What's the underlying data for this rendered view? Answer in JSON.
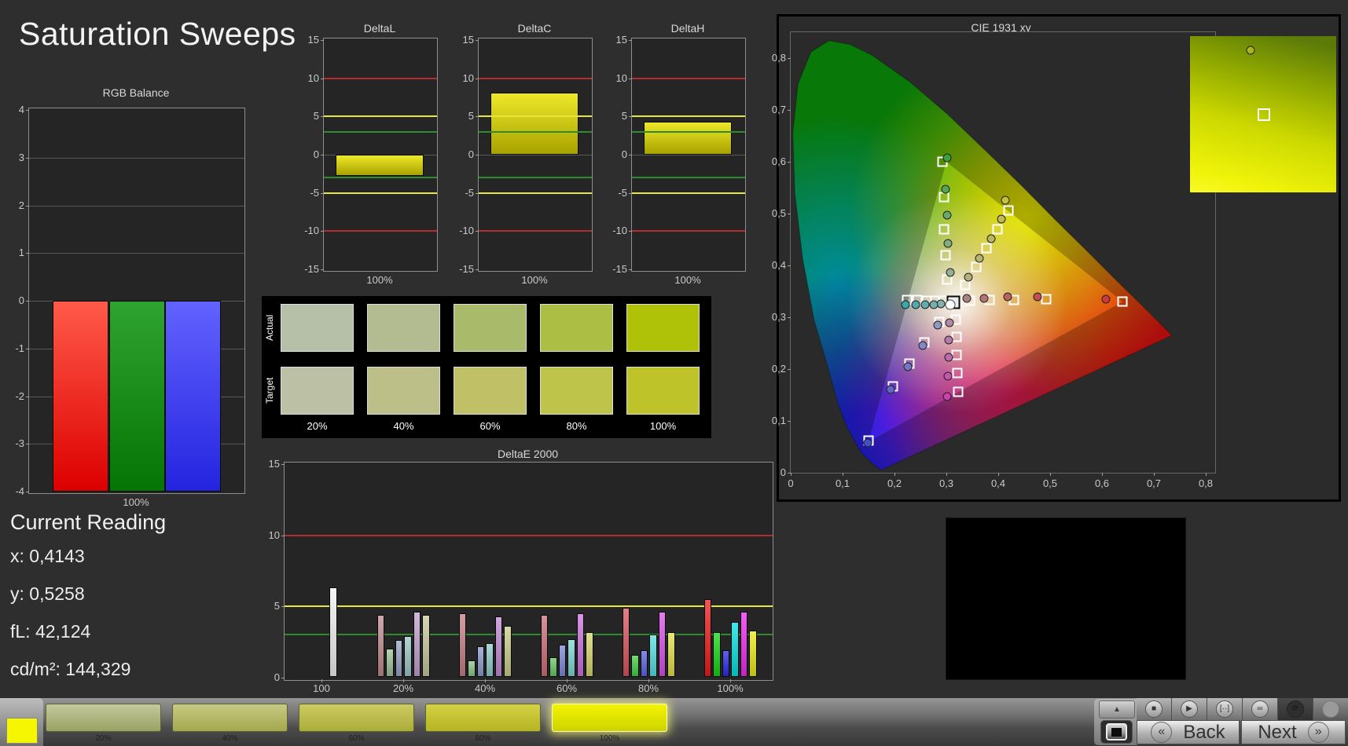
{
  "page": {
    "title": "Saturation Sweeps"
  },
  "reading": {
    "heading": "Current Reading",
    "items": [
      {
        "label": "x",
        "value": "0,4143"
      },
      {
        "label": "y",
        "value": "0,5258"
      },
      {
        "label": "fL",
        "value": "42,124"
      },
      {
        "label": "cd/m²",
        "value": "144,329"
      }
    ]
  },
  "rgb_balance": {
    "title": "RGB Balance",
    "x_label": "100%",
    "y_ticks": [
      4,
      3,
      2,
      1,
      0,
      -1,
      -2,
      -3,
      -4
    ],
    "bars": [
      {
        "name": "red",
        "value": -4,
        "c1": "#ff5a4a",
        "c2": "#dc0000"
      },
      {
        "name": "green",
        "value": -4,
        "c1": "#2fa32f",
        "c2": "#057505"
      },
      {
        "name": "blue",
        "value": -4,
        "c1": "#6262ff",
        "c2": "#2424e0"
      }
    ]
  },
  "delta_charts": {
    "y_ticks": [
      15,
      10,
      5,
      0,
      -5,
      -10,
      -15
    ],
    "x_label": "100%",
    "limit_lines": [
      {
        "value": 10,
        "color": "#b62b2b"
      },
      {
        "value": -10,
        "color": "#b62b2b"
      },
      {
        "value": 5,
        "color": "#e6e63e"
      },
      {
        "value": -5,
        "color": "#e6e63e"
      },
      {
        "value": 3,
        "color": "#2e8b2e"
      },
      {
        "value": -3,
        "color": "#2e8b2e"
      }
    ],
    "bar_c1": "#eee82a",
    "bar_c2": "#a8a200",
    "charts": [
      {
        "title": "DeltaL",
        "value": -2.8
      },
      {
        "title": "DeltaC",
        "value": 8.1
      },
      {
        "title": "DeltaH",
        "value": 4.3
      }
    ]
  },
  "swatch_panel": {
    "row_labels": [
      "Actual",
      "Target"
    ],
    "col_labels": [
      "20%",
      "40%",
      "60%",
      "80%",
      "100%"
    ],
    "actual": [
      "#b6bfa8",
      "#b2bc90",
      "#a9bb6b",
      "#adbe45",
      "#b0c207"
    ],
    "target": [
      "#bcc0a5",
      "#bdbf88",
      "#c0c166",
      "#bec34a",
      "#bdc329"
    ]
  },
  "deltae": {
    "title": "DeltaE 2000",
    "y_ticks": [
      15,
      10,
      5,
      0
    ],
    "limit_lines": [
      {
        "value": 10,
        "color": "#b62b2b"
      },
      {
        "value": 5,
        "color": "#e6e63e"
      },
      {
        "value": 3,
        "color": "#2e8b2e"
      }
    ],
    "groups": [
      {
        "label": "100",
        "bars": [
          {
            "value": 6.3,
            "color": "#f2f2f2"
          }
        ]
      },
      {
        "label": "20%",
        "bars": [
          {
            "value": 4.4,
            "color": "#c08a90"
          },
          {
            "value": 2.0,
            "color": "#9fc19a"
          },
          {
            "value": 2.6,
            "color": "#9aa3c6"
          },
          {
            "value": 2.9,
            "color": "#9cc6c6"
          },
          {
            "value": 4.6,
            "color": "#c2a0ce"
          },
          {
            "value": 4.4,
            "color": "#c6c79e"
          }
        ]
      },
      {
        "label": "40%",
        "bars": [
          {
            "value": 4.5,
            "color": "#c47e86"
          },
          {
            "value": 1.2,
            "color": "#8cc487"
          },
          {
            "value": 2.2,
            "color": "#8d99cc"
          },
          {
            "value": 2.4,
            "color": "#8ecccc"
          },
          {
            "value": 4.3,
            "color": "#c28ad4"
          },
          {
            "value": 3.6,
            "color": "#cccc8c"
          }
        ]
      },
      {
        "label": "60%",
        "bars": [
          {
            "value": 4.4,
            "color": "#cc6e78"
          },
          {
            "value": 1.4,
            "color": "#66c666"
          },
          {
            "value": 2.3,
            "color": "#7c87d8"
          },
          {
            "value": 2.7,
            "color": "#7ed6d6"
          },
          {
            "value": 4.5,
            "color": "#cc70de"
          },
          {
            "value": 3.2,
            "color": "#d6d66e"
          }
        ]
      },
      {
        "label": "80%",
        "bars": [
          {
            "value": 4.9,
            "color": "#d8545f"
          },
          {
            "value": 1.6,
            "color": "#44d044"
          },
          {
            "value": 1.9,
            "color": "#5a64e2"
          },
          {
            "value": 3.0,
            "color": "#50e0e0"
          },
          {
            "value": 4.6,
            "color": "#da50ea"
          },
          {
            "value": 3.2,
            "color": "#e0e04a"
          }
        ]
      },
      {
        "label": "100%",
        "bars": [
          {
            "value": 5.5,
            "color": "#ee1c1c"
          },
          {
            "value": 3.2,
            "color": "#16d416"
          },
          {
            "value": 1.9,
            "color": "#2a2ae8"
          },
          {
            "value": 3.9,
            "color": "#00e2e2"
          },
          {
            "value": 4.6,
            "color": "#ee2aee"
          },
          {
            "value": 3.3,
            "color": "#e8e818"
          }
        ]
      }
    ]
  },
  "cie": {
    "title": "CIE 1931 xy",
    "x_ticks": [
      "0",
      "0,1",
      "0,2",
      "0,3",
      "0,4",
      "0,5",
      "0,6",
      "0,7",
      "0,8"
    ],
    "y_ticks": [
      "0,8",
      "0,7",
      "0,6",
      "0,5",
      "0,4",
      "0,3",
      "0,2",
      "0,1",
      "0"
    ],
    "triangle": {
      "red": [
        0.64,
        0.33
      ],
      "green": [
        0.3,
        0.6
      ],
      "blue": [
        0.15,
        0.06
      ]
    },
    "white_point": {
      "target": [
        0.313,
        0.329
      ],
      "measured": [
        0.307,
        0.325
      ]
    },
    "sweeps": [
      {
        "name": "red",
        "targets": [
          [
            0.345,
            0.332
          ],
          [
            0.383,
            0.333
          ],
          [
            0.43,
            0.334
          ],
          [
            0.492,
            0.335
          ],
          [
            0.64,
            0.33
          ]
        ],
        "measured": [
          [
            0.34,
            0.336
          ],
          [
            0.372,
            0.337
          ],
          [
            0.418,
            0.339
          ],
          [
            0.475,
            0.34
          ],
          [
            0.608,
            0.335
          ]
        ],
        "colors": [
          "#ab8282",
          "#b27474",
          "#b96262",
          "#c25050",
          "#cc3a3a"
        ]
      },
      {
        "name": "green",
        "targets": [
          [
            0.302,
            0.372
          ],
          [
            0.298,
            0.42
          ],
          [
            0.296,
            0.47
          ],
          [
            0.295,
            0.532
          ],
          [
            0.293,
            0.6
          ]
        ],
        "measured": [
          [
            0.307,
            0.387
          ],
          [
            0.303,
            0.442
          ],
          [
            0.301,
            0.497
          ],
          [
            0.299,
            0.547
          ],
          [
            0.302,
            0.608
          ]
        ],
        "colors": [
          "#93b093",
          "#7fae7f",
          "#68ab68",
          "#52a852",
          "#3aa43a"
        ]
      },
      {
        "name": "blue",
        "targets": [
          [
            0.287,
            0.291
          ],
          [
            0.258,
            0.252
          ],
          [
            0.229,
            0.211
          ],
          [
            0.197,
            0.167
          ],
          [
            0.15,
            0.062
          ]
        ],
        "measured": [
          [
            0.283,
            0.285
          ],
          [
            0.254,
            0.246
          ],
          [
            0.225,
            0.205
          ],
          [
            0.193,
            0.161
          ],
          [
            0.149,
            0.057
          ]
        ],
        "colors": [
          "#9298c4",
          "#8189c6",
          "#7078c8",
          "#5f68ca",
          "#4550c8"
        ]
      },
      {
        "name": "cyan",
        "targets": [
          [
            0.294,
            0.332
          ],
          [
            0.279,
            0.332
          ],
          [
            0.262,
            0.332
          ],
          [
            0.244,
            0.333
          ],
          [
            0.224,
            0.333
          ]
        ],
        "measured": [
          [
            0.29,
            0.326
          ],
          [
            0.276,
            0.325
          ],
          [
            0.259,
            0.325
          ],
          [
            0.241,
            0.324
          ],
          [
            0.221,
            0.324
          ]
        ],
        "colors": [
          "#84b0b0",
          "#74b0b0",
          "#62aeae",
          "#50acac",
          "#3aa8a8"
        ]
      },
      {
        "name": "magenta",
        "targets": [
          [
            0.318,
            0.296
          ],
          [
            0.319,
            0.262
          ],
          [
            0.32,
            0.228
          ],
          [
            0.321,
            0.193
          ],
          [
            0.322,
            0.156
          ]
        ],
        "measured": [
          [
            0.306,
            0.29
          ],
          [
            0.305,
            0.256
          ],
          [
            0.304,
            0.222
          ],
          [
            0.303,
            0.187
          ],
          [
            0.302,
            0.147
          ]
        ],
        "colors": [
          "#b288a6",
          "#b77aa8",
          "#bd69ab",
          "#c456ae",
          "#cc40b0"
        ]
      },
      {
        "name": "yellow",
        "targets": [
          [
            0.337,
            0.362
          ],
          [
            0.357,
            0.397
          ],
          [
            0.378,
            0.433
          ],
          [
            0.399,
            0.469
          ],
          [
            0.42,
            0.506
          ]
        ],
        "measured": [
          [
            0.342,
            0.377
          ],
          [
            0.364,
            0.414
          ],
          [
            0.386,
            0.452
          ],
          [
            0.406,
            0.489
          ],
          [
            0.414,
            0.526
          ]
        ],
        "colors": [
          "#b0b07e",
          "#b4b470",
          "#bab85e",
          "#c0bc4e",
          "#c6c03a"
        ]
      }
    ],
    "inset": {
      "circle_color": "#a8b818"
    }
  },
  "toolbar": {
    "patch_color": "#f6f600",
    "saturation_buttons": [
      {
        "label": "20%",
        "c1": "#c4c89e",
        "c2": "#99a363",
        "selected": false
      },
      {
        "label": "40%",
        "c1": "#c8c983",
        "c2": "#a3a84e",
        "selected": false
      },
      {
        "label": "60%",
        "c1": "#cdcb62",
        "c2": "#abad3a",
        "selected": false
      },
      {
        "label": "80%",
        "c1": "#d5d145",
        "c2": "#b5b424",
        "selected": false
      },
      {
        "label": "100%",
        "c1": "#f4f400",
        "c2": "#cdd300",
        "selected": true
      }
    ],
    "up_button_glyph": "▲",
    "transport_buttons": [
      {
        "name": "stop",
        "glyph": "■",
        "style": "normal"
      },
      {
        "name": "play",
        "glyph": "▶",
        "style": "normal"
      },
      {
        "name": "segment",
        "glyph": "[··]",
        "style": "normal"
      },
      {
        "name": "loop",
        "glyph": "∞",
        "style": "normal"
      },
      {
        "name": "refresh",
        "glyph": "⟳",
        "style": "dark"
      },
      {
        "name": "empty",
        "glyph": "",
        "style": "empty"
      }
    ],
    "back_label": "Back",
    "next_label": "Next",
    "back_chevron": "«",
    "next_chevron": "»"
  }
}
